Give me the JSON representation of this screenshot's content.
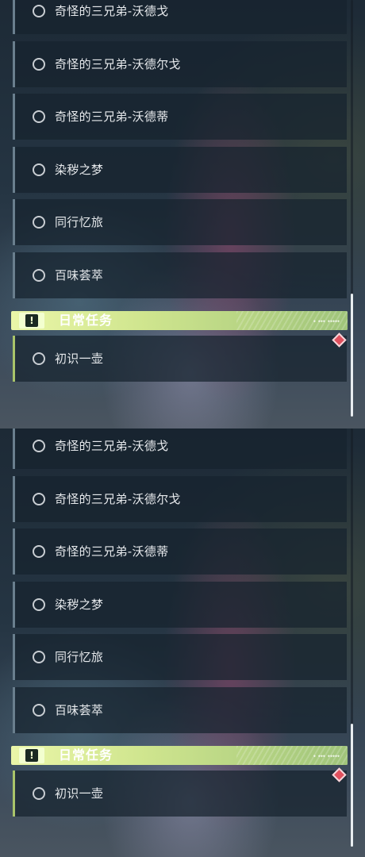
{
  "panels": [
    {
      "items": [
        {
          "label": "奇怪的三兄弟-沃德戈"
        },
        {
          "label": "奇怪的三兄弟-沃德尔戈"
        },
        {
          "label": "奇怪的三兄弟-沃德蒂"
        },
        {
          "label": "染秽之梦"
        },
        {
          "label": "同行忆旅"
        },
        {
          "label": "百味荟萃"
        }
      ],
      "daily_section": {
        "title": "日常任务",
        "icon": "exclamation-icon",
        "decoration_text": "◆ ◆◆◆ ◆◆◆◆◆",
        "items": [
          {
            "label": "初识一壶"
          }
        ]
      }
    },
    {
      "items": [
        {
          "label": "奇怪的三兄弟-沃德戈"
        },
        {
          "label": "奇怪的三兄弟-沃德尔戈"
        },
        {
          "label": "奇怪的三兄弟-沃德蒂"
        },
        {
          "label": "染秽之梦"
        },
        {
          "label": "同行忆旅"
        },
        {
          "label": "百味荟萃"
        }
      ],
      "daily_section": {
        "title": "日常任务",
        "icon": "exclamation-icon",
        "decoration_text": "◆ ◆◆◆ ◆◆◆◆◆",
        "items": [
          {
            "label": "初识一壶"
          }
        ]
      }
    }
  ],
  "colors": {
    "daily_header_accent": "#cfe58e",
    "daily_item_border": "#a9c46a",
    "item_border": "#6a7f8e",
    "marker_diamond": "#e0505e"
  }
}
